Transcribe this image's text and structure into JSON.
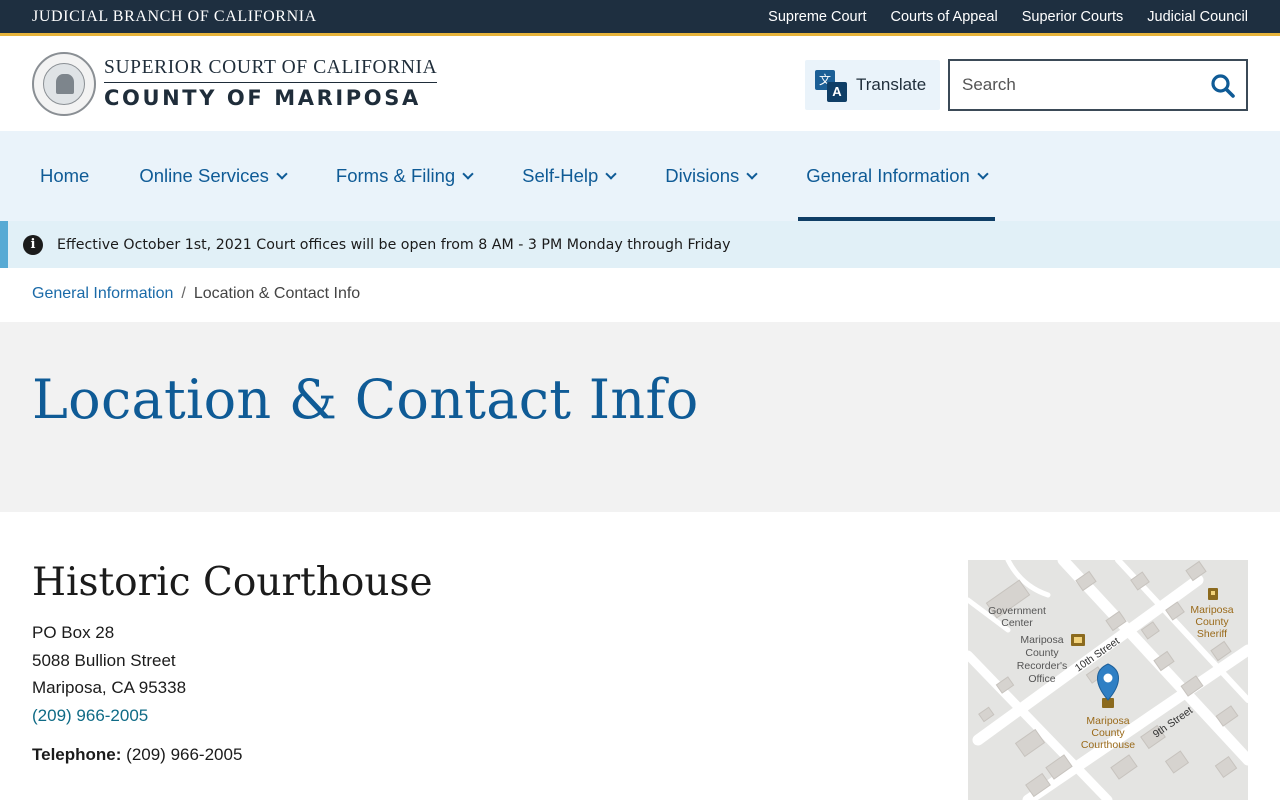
{
  "topbar": {
    "brand": "JUDICIAL BRANCH OF CALIFORNIA",
    "links": [
      "Supreme Court",
      "Courts of Appeal",
      "Superior Courts",
      "Judicial Council"
    ]
  },
  "header": {
    "court_line1": "SUPERIOR COURT OF CALIFORNIA",
    "court_line2": "COUNTY OF MARIPOSA",
    "translate_label": "Translate",
    "search_placeholder": "Search"
  },
  "nav": {
    "items": [
      {
        "label": "Home"
      },
      {
        "label": "Online Services"
      },
      {
        "label": "Forms & Filing"
      },
      {
        "label": "Self-Help"
      },
      {
        "label": "Divisions"
      },
      {
        "label": "General Information"
      }
    ]
  },
  "alert": {
    "text": "Effective October 1st, 2021 Court offices will be open from 8 AM - 3 PM Monday through Friday"
  },
  "breadcrumb": {
    "parent": "General Information",
    "separator": "/",
    "current": "Location & Contact Info"
  },
  "page": {
    "title": "Location & Contact Info"
  },
  "location": {
    "name": "Historic Courthouse",
    "address_lines": [
      "PO Box 28",
      "5088 Bullion Street",
      "Mariposa, CA 95338"
    ],
    "phone_link": "(209) 966-2005",
    "telephone_label": "Telephone:",
    "telephone_value": "(209) 966-2005"
  },
  "map": {
    "labels": {
      "gov_center_1": "Government",
      "gov_center_2": "Center",
      "recorder_1": "Mariposa",
      "recorder_2": "County",
      "recorder_3": "Recorder's",
      "recorder_4": "Office",
      "sheriff_1": "Mariposa",
      "sheriff_2": "County",
      "sheriff_3": "Sheriff",
      "courthouse_1": "Mariposa",
      "courthouse_2": "County",
      "courthouse_3": "Courthouse",
      "street_10": "10th Street",
      "street_9": "9th Street"
    }
  }
}
